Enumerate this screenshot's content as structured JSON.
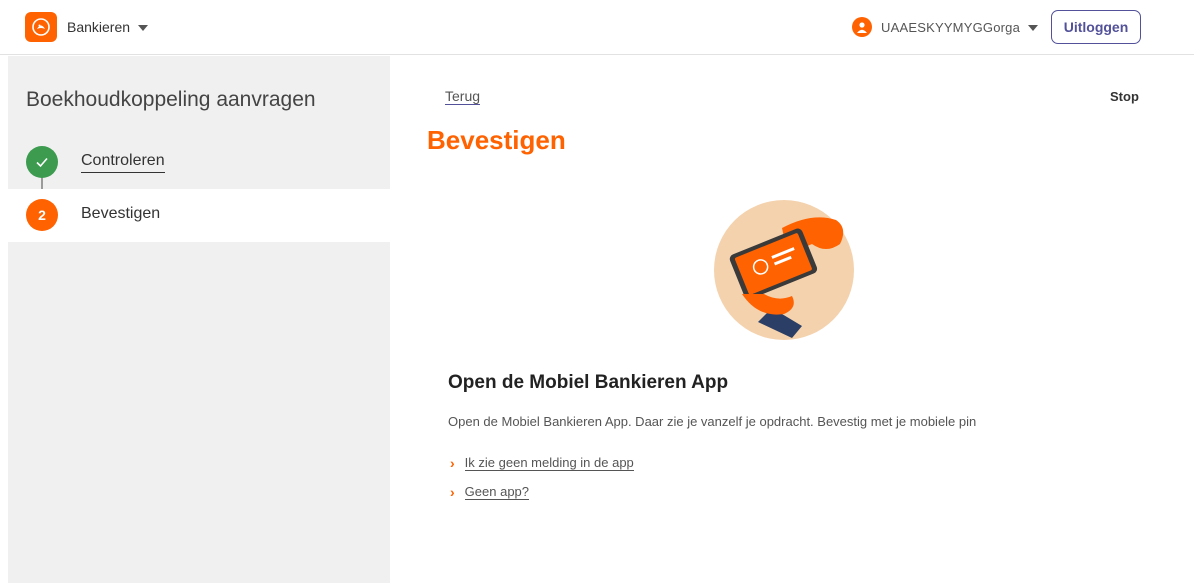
{
  "header": {
    "brand_label": "Bankieren",
    "user_name": "UAAESKYYMYGGorga",
    "logout_label": "Uitloggen"
  },
  "sidebar": {
    "title": "Boekhoudkoppeling aanvragen",
    "steps": [
      {
        "number": "✓",
        "label": "Controleren",
        "status": "completed"
      },
      {
        "number": "2",
        "label": "Bevestigen",
        "status": "active"
      }
    ]
  },
  "main": {
    "back_label": "Terug",
    "stop_label": "Stop",
    "title": "Bevestigen",
    "card_title": "Open de Mobiel Bankieren App",
    "card_text": "Open de Mobiel Bankieren App. Daar zie je vanzelf je opdracht. Bevestig met je mobiele pin",
    "links": [
      {
        "label": "Ik zie geen melding in de app"
      },
      {
        "label": "Geen app?"
      }
    ]
  },
  "colors": {
    "brand_orange": "#ff6200",
    "success_green": "#3c9b4f",
    "link_indigo": "#525199",
    "sidebar_bg": "#f0f0f0"
  },
  "icons": [
    "lion-logo-icon",
    "chevron-down-icon",
    "user-icon",
    "check-icon",
    "chevron-right-icon",
    "phone-app-illustration"
  ]
}
